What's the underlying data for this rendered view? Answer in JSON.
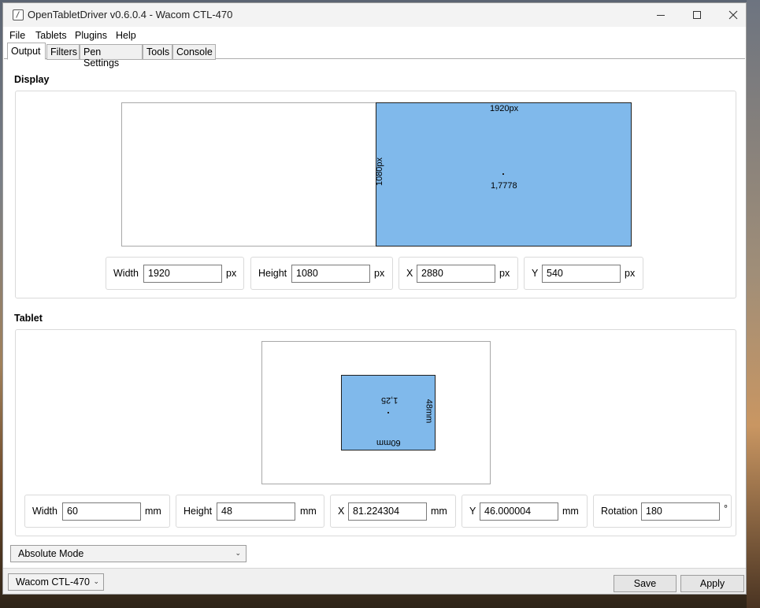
{
  "window": {
    "title": "OpenTabletDriver v0.6.0.4 - Wacom CTL-470"
  },
  "menu": [
    "File",
    "Tablets",
    "Plugins",
    "Help"
  ],
  "tabs": [
    "Output",
    "Filters",
    "Pen Settings",
    "Tools",
    "Console"
  ],
  "display": {
    "section_title": "Display",
    "area_width_label": "1920px",
    "area_height_label": "1080px",
    "aspect_label": "1,7778",
    "fields": {
      "width": {
        "label": "Width",
        "value": "1920",
        "unit": "px"
      },
      "height": {
        "label": "Height",
        "value": "1080",
        "unit": "px"
      },
      "x": {
        "label": "X",
        "value": "2880",
        "unit": "px"
      },
      "y": {
        "label": "Y",
        "value": "540",
        "unit": "px"
      }
    }
  },
  "tablet": {
    "section_title": "Tablet",
    "area_width_label": "60mm",
    "area_height_label": "48mm",
    "aspect_label": "1,25",
    "fields": {
      "width": {
        "label": "Width",
        "value": "60",
        "unit": "mm"
      },
      "height": {
        "label": "Height",
        "value": "48",
        "unit": "mm"
      },
      "x": {
        "label": "X",
        "value": "81.224304",
        "unit": "mm"
      },
      "y": {
        "label": "Y",
        "value": "46.000004",
        "unit": "mm"
      },
      "rotation": {
        "label": "Rotation",
        "value": "180",
        "unit": "°"
      }
    }
  },
  "output_mode": {
    "selected": "Absolute Mode"
  },
  "bottom": {
    "device_selected": "Wacom CTL-470",
    "save_label": "Save",
    "apply_label": "Apply"
  },
  "colors": {
    "area_fill": "#80b9eb",
    "area_border": "#1f1f1f"
  }
}
